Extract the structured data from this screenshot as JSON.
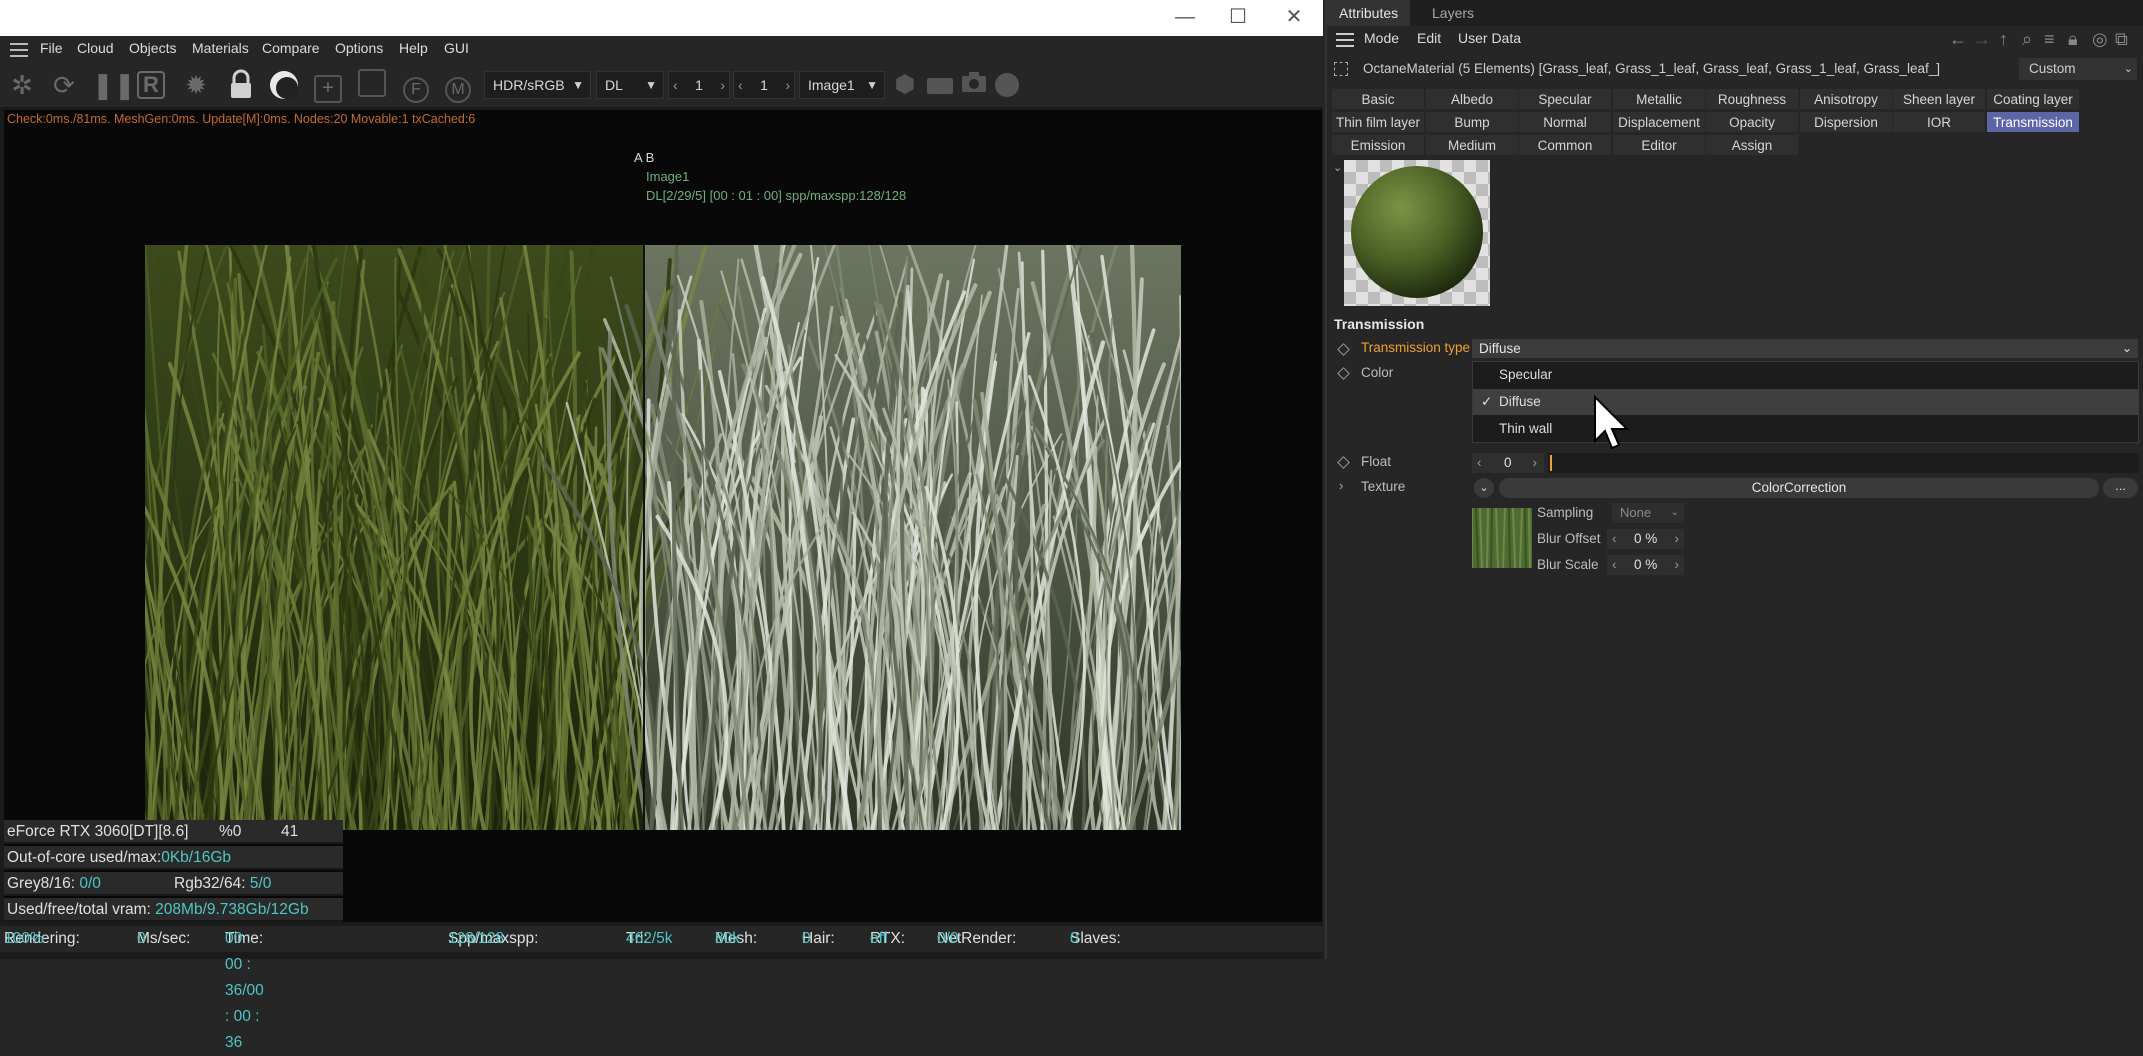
{
  "window": {
    "minimize": "—",
    "maximize": "☐",
    "close": "✕"
  },
  "menubar": {
    "items": [
      "File",
      "Cloud",
      "Objects",
      "Materials",
      "Compare",
      "Options",
      "Help",
      "GUI"
    ]
  },
  "toolbar": {
    "colorspace": "HDR/sRGB",
    "kernel": "DL",
    "num1": "1",
    "num2": "1",
    "image_select": "Image1"
  },
  "viewport": {
    "status_line": "Check:0ms./81ms. MeshGen:0ms. Update[M]:0ms. Nodes:20 Movable:1 txCached:6",
    "ab": "A  B",
    "image_name": "Image1",
    "dl_info": "DL[2/29/5] [00 : 01 : 00] spp/maxspp:128/128"
  },
  "stats": {
    "gpu": "eForce RTX 3060[DT][8.6]",
    "gpu_pct": "%0",
    "gpu_temp": "41",
    "ooc_label": "Out-of-core used/max:",
    "ooc_value": "0Kb/16Gb",
    "grey_label": "Grey8/16: ",
    "grey_value": "0/0",
    "rgb_label": "Rgb32/64: ",
    "rgb_value": "5/0",
    "vram_label": "Used/free/total vram: ",
    "vram_value": "208Mb/9.738Gb/12Gb"
  },
  "bottombar": {
    "rendering_label": "Rendering: ",
    "rendering_value": "100%",
    "mssec_label": "Ms/sec: ",
    "mssec_value": "0",
    "time_label": "Time: ",
    "time_value": "00 : 00 : 36/00 : 00 : 36",
    "spp_label": "Spp/maxspp: ",
    "spp_value": "128/128",
    "tri_label": "Tri: ",
    "tri_value": "462/5k",
    "mesh_label": "Mesh: ",
    "mesh_value": "80k",
    "hair_label": "Hair: ",
    "hair_value": "0",
    "rtx_label": "RTX:",
    "rtx_value": "off",
    "netrender_label": "NetRender: ",
    "netrender_value": "0/0",
    "slaves_label": "Slaves: ",
    "slaves_value": "0"
  },
  "right": {
    "tabs": [
      "Attributes",
      "Layers"
    ],
    "menu": [
      "Mode",
      "Edit",
      "User Data"
    ],
    "object_line": "OctaneMaterial (5 Elements) [Grass_leaf, Grass_1_leaf, Grass_leaf, Grass_1_leaf, Grass_leaf_]",
    "custom": "Custom",
    "prop_tabs_row1": [
      "Basic",
      "Albedo",
      "Specular",
      "Metallic",
      "Roughness",
      "Anisotropy",
      "Sheen layer",
      "Coating layer"
    ],
    "prop_tabs_row2": [
      "Thin film layer",
      "Bump",
      "Normal",
      "Displacement",
      "Opacity",
      "Dispersion",
      "IOR",
      "Transmission"
    ],
    "prop_tabs_row3": [
      "Emission",
      "Medium",
      "Common",
      "Editor",
      "Assign"
    ],
    "section": "Transmission",
    "transmission_type_label": "Transmission type",
    "transmission_type_value": "Diffuse",
    "dropdown_options": [
      "Specular",
      "Diffuse",
      "Thin wall"
    ],
    "color_label": "Color",
    "float_label": "Float",
    "float_value": "0",
    "texture_label": "Texture",
    "texture_value": "ColorCorrection",
    "more": "...",
    "sampling_label": "Sampling",
    "sampling_value": "None",
    "blur_offset_label": "Blur Offset",
    "blur_offset_value": "0 %",
    "blur_scale_label": "Blur Scale",
    "blur_scale_value": "0 %"
  }
}
